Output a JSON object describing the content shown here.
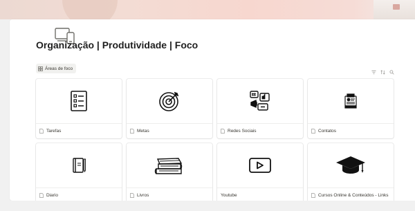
{
  "page": {
    "title": "Organização | Produtividade | Foco",
    "icon": "devices-icon"
  },
  "database": {
    "view_tab_label": "Áreas de foco",
    "view_icon": "gallery-icon",
    "toolbar_icons": [
      "filter-icon",
      "sort-icon",
      "search-icon"
    ]
  },
  "cards": [
    {
      "label": "Tarefas",
      "icon": "checklist-icon"
    },
    {
      "label": "Metas",
      "icon": "target-icon"
    },
    {
      "label": "Redes Sociais",
      "icon": "social-media-icon"
    },
    {
      "label": "Contatos",
      "icon": "contact-card-icon"
    },
    {
      "label": "Diario",
      "icon": "journal-icon"
    },
    {
      "label": "Livros",
      "icon": "books-icon"
    },
    {
      "label": "Youtube",
      "icon": "play-button-icon"
    },
    {
      "label": "Cursos Online & Conteúdos - Links",
      "icon": "graduation-cap-icon"
    }
  ],
  "colors": {
    "cover_gradient_start": "#ecd9d2",
    "cover_gradient_mid": "#f7d7cf",
    "page_background": "#ffffff",
    "outer_background": "#f1f1f1",
    "text": "#37352f"
  }
}
